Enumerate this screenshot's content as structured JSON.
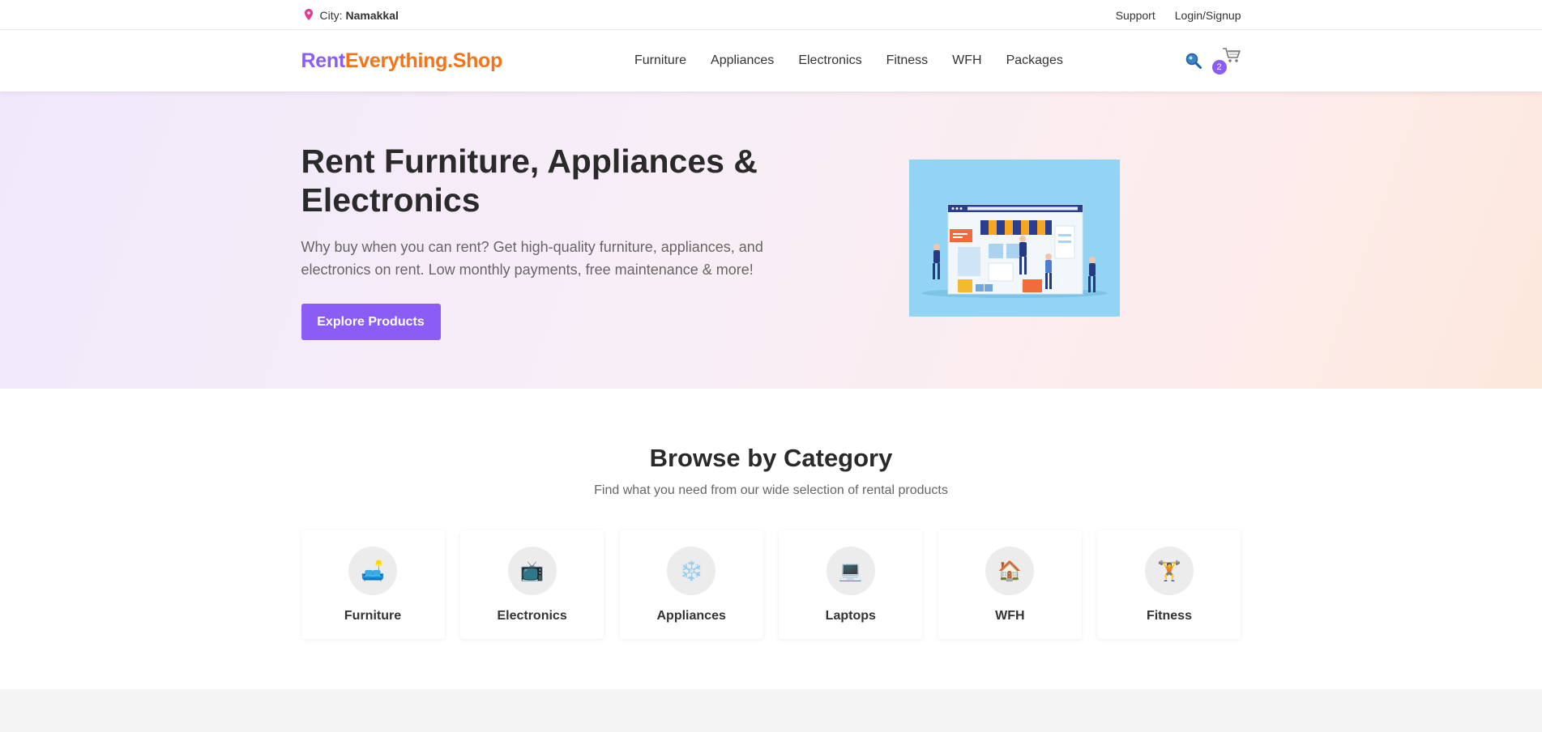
{
  "topbar": {
    "city_label": "City:",
    "city_value": "Namakkal",
    "support": "Support",
    "login": "Login/Signup"
  },
  "header": {
    "logo_part1": "Rent",
    "logo_part2": "Everything.Shop",
    "nav": [
      "Furniture",
      "Appliances",
      "Electronics",
      "Fitness",
      "WFH",
      "Packages"
    ],
    "cart_count": "2"
  },
  "hero": {
    "title": "Rent Furniture, Appliances & Electronics",
    "description": "Why buy when you can rent? Get high-quality furniture, appliances, and electronics on rent. Low monthly payments, free maintenance & more!",
    "cta": "Explore Products"
  },
  "categories": {
    "title": "Browse by Category",
    "subtitle": "Find what you need from our wide selection of rental products",
    "items": [
      {
        "label": "Furniture",
        "icon": "🛋️"
      },
      {
        "label": "Electronics",
        "icon": "📺"
      },
      {
        "label": "Appliances",
        "icon": "❄️"
      },
      {
        "label": "Laptops",
        "icon": "💻"
      },
      {
        "label": "WFH",
        "icon": "🏠"
      },
      {
        "label": "Fitness",
        "icon": "🏋️"
      }
    ]
  },
  "colors": {
    "brand_purple": "#8b5cf6",
    "brand_orange": "#f97316"
  }
}
